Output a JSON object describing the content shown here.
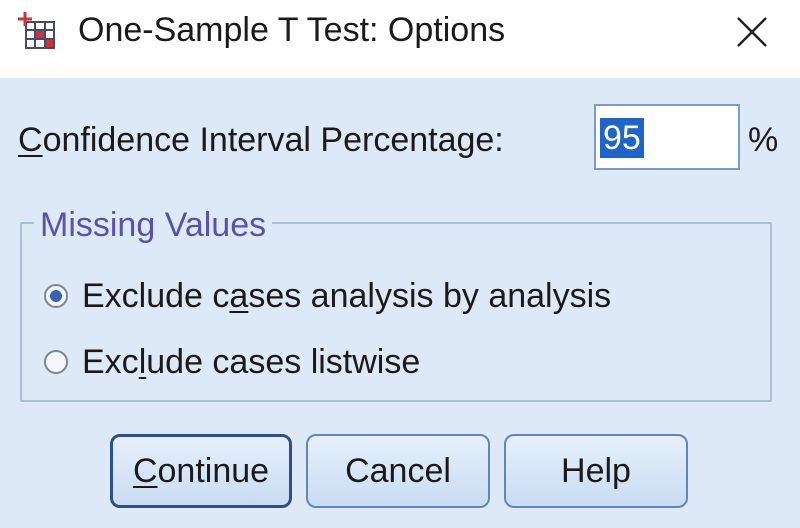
{
  "window": {
    "title": "One-Sample T Test: Options",
    "app_icon": "spss-table-icon",
    "close_icon": "close-x-icon"
  },
  "confidence": {
    "label_mnemonic": "C",
    "label_rest": "onfidence Interval Percentage:",
    "value": "95",
    "unit": "%"
  },
  "missing_values": {
    "legend": "Missing Values",
    "options": [
      {
        "pre": "Exclude c",
        "mnemonic": "a",
        "post": "ses analysis by analysis",
        "checked": true
      },
      {
        "pre": "Exc",
        "mnemonic": "l",
        "post": "ude cases listwise",
        "checked": false
      }
    ]
  },
  "buttons": {
    "continue_mnemonic": "C",
    "continue_rest": "ontinue",
    "cancel": "Cancel",
    "help": "Help"
  },
  "colors": {
    "background": "#dde9f6",
    "selection": "#1f64c8",
    "legend_text": "#5a52a6",
    "button_border": "#5f86bd"
  }
}
